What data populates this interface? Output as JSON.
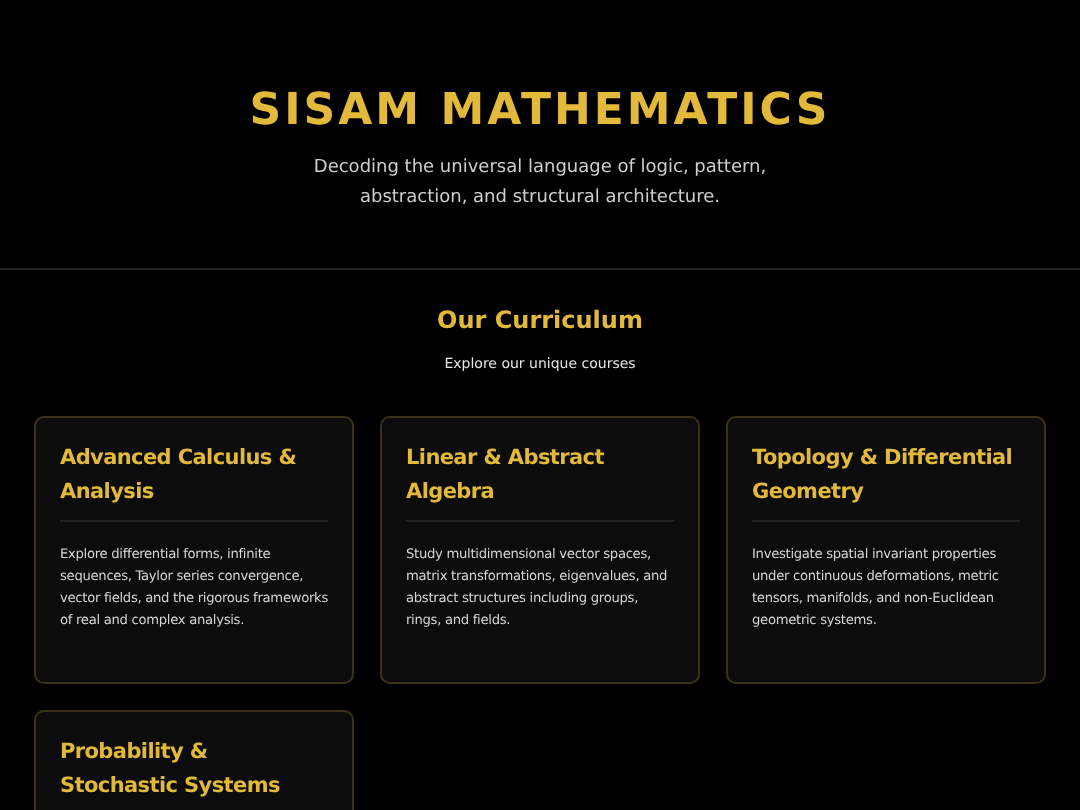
{
  "header": {
    "title": "SISAM MATHEMATICS",
    "tagline": "Decoding the universal language of logic, pattern, abstraction, and structural architecture."
  },
  "curriculum": {
    "heading": "Our Curriculum",
    "subheading": "Explore our unique courses",
    "courses": [
      {
        "title": "Advanced Calculus & Analysis",
        "description": "Explore differential forms, infinite sequences, Taylor series convergence, vector fields, and the rigorous frameworks of real and complex analysis."
      },
      {
        "title": "Linear & Abstract Algebra",
        "description": "Study multidimensional vector spaces, matrix transformations, eigenvalues, and abstract structures including groups, rings, and fields."
      },
      {
        "title": "Topology & Differential Geometry",
        "description": "Investigate spatial invariant properties under continuous deformations, metric tensors, manifolds, and non-Euclidean geometric systems."
      },
      {
        "title": "Probability & Stochastic Systems"
      }
    ]
  }
}
